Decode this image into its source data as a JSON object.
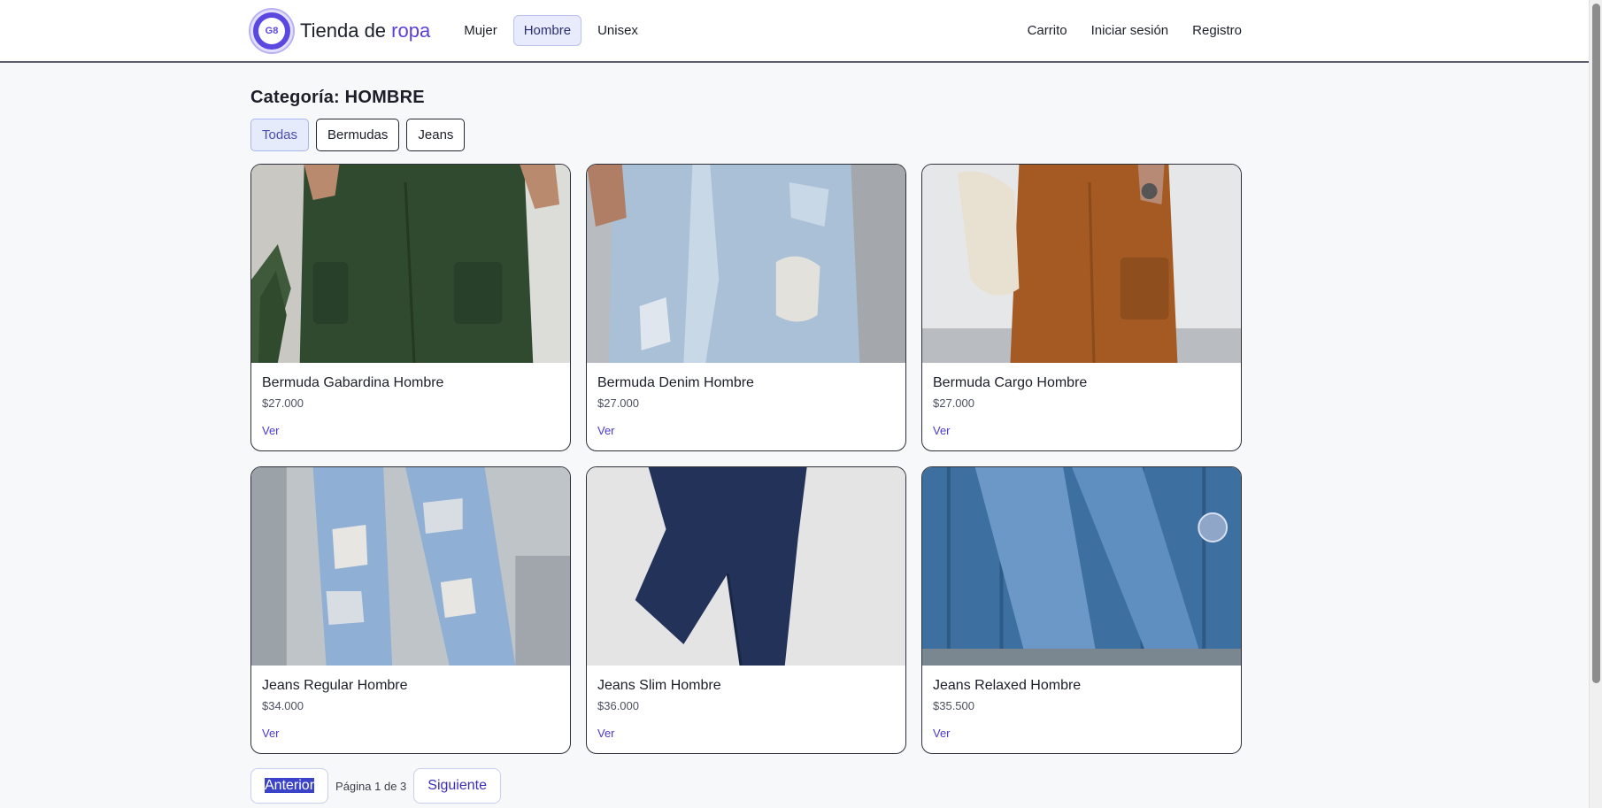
{
  "header": {
    "logo_text": "G8",
    "brand_prefix": "Tienda de ",
    "brand_accent": "ropa",
    "nav": [
      {
        "label": "Mujer"
      },
      {
        "label": "Hombre"
      },
      {
        "label": "Unisex"
      }
    ],
    "right_links": [
      {
        "label": "Carrito"
      },
      {
        "label": "Iniciar sesión"
      },
      {
        "label": "Registro"
      }
    ]
  },
  "main": {
    "category_label": "Categoría:",
    "category_value": "HOMBRE",
    "filters": [
      {
        "label": "Todas"
      },
      {
        "label": "Bermudas"
      },
      {
        "label": "Jeans"
      }
    ],
    "products": [
      {
        "name": "Bermuda Gabardina Hombre",
        "price": "$27.000",
        "link": "Ver",
        "image": "green-cargo-pants"
      },
      {
        "name": "Bermuda Denim Hombre",
        "price": "$27.000",
        "link": "Ver",
        "image": "ripped-light-denim"
      },
      {
        "name": "Bermuda Cargo Hombre",
        "price": "$27.000",
        "link": "Ver",
        "image": "brown-cargo-pants"
      },
      {
        "name": "Jeans Regular Hombre",
        "price": "$34.000",
        "link": "Ver",
        "image": "ripped-blue-jeans"
      },
      {
        "name": "Jeans Slim Hombre",
        "price": "$36.000",
        "link": "Ver",
        "image": "navy-slim-jeans"
      },
      {
        "name": "Jeans Relaxed Hombre",
        "price": "$35.500",
        "link": "Ver",
        "image": "relaxed-jeans-container"
      }
    ],
    "pagination": {
      "prev_label": "Anterior",
      "info": "Página 1 de 3",
      "next_label": "Siguiente"
    }
  },
  "colors": {
    "accent": "#5b3fd6",
    "background": "#f7f8fa",
    "card_border": "#2d3039"
  }
}
